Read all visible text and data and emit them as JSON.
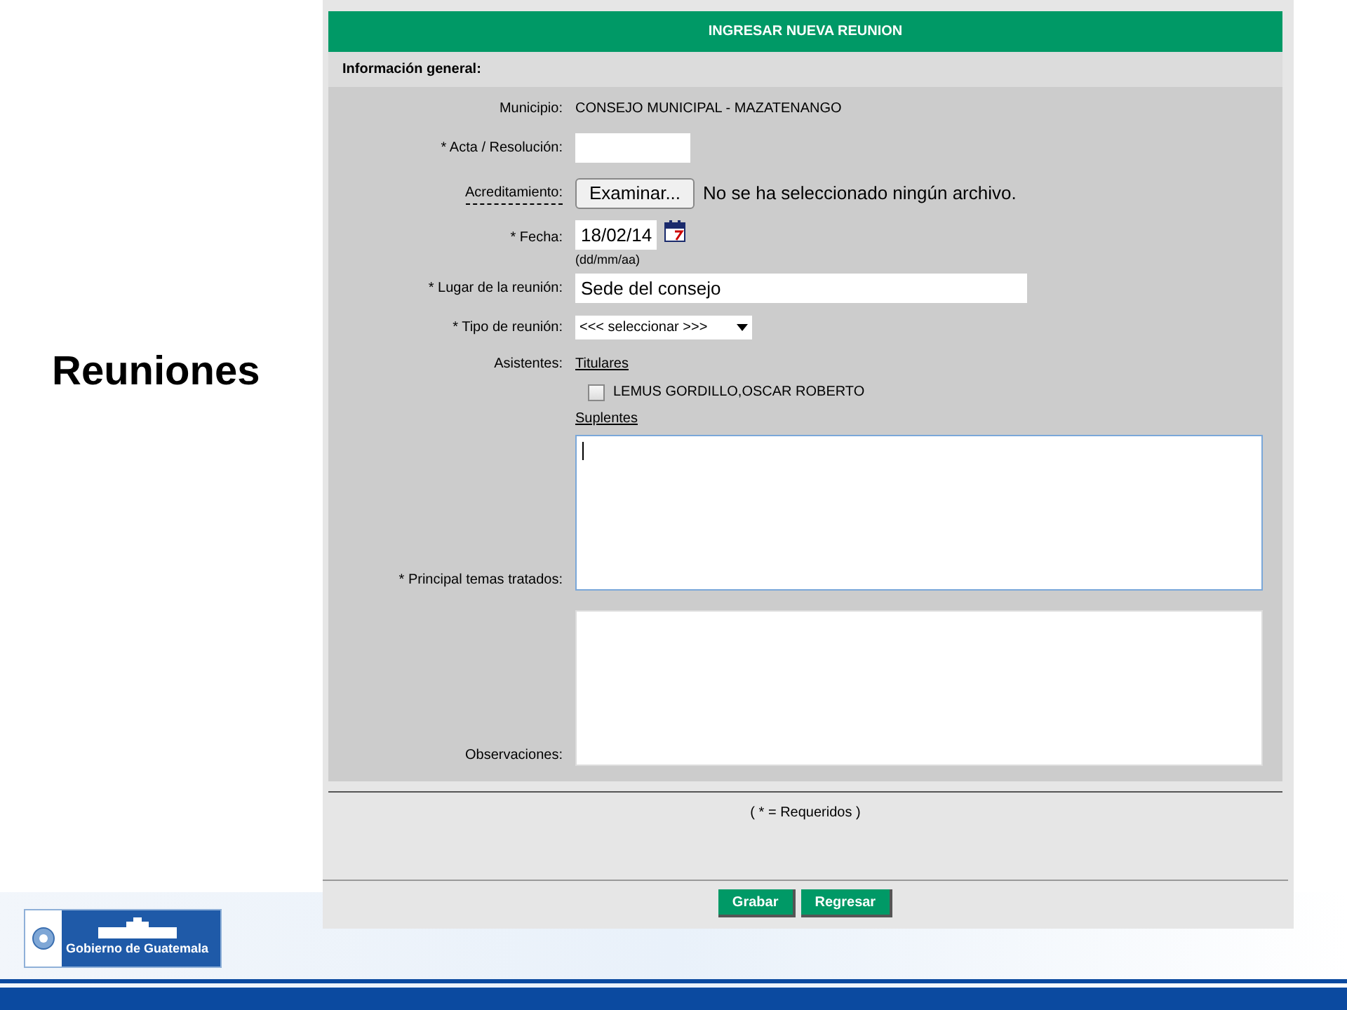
{
  "slide_title": "Reuniones",
  "form": {
    "header": "INGRESAR NUEVA REUNION",
    "section": "Información general:",
    "fields": [
      {
        "kind": "static",
        "label": "Municipio:",
        "value": "CONSEJO MUNICIPAL - MAZATENANGO"
      },
      {
        "kind": "text",
        "label": "* Acta / Resolución:"
      },
      {
        "kind": "file",
        "label": "Acreditamiento:",
        "button": "Examinar...",
        "status": "No se ha seleccionado ningún archivo."
      },
      {
        "kind": "date",
        "label": "* Fecha:",
        "value": "18/02/14",
        "hint": "(dd/mm/aa)"
      },
      {
        "kind": "wide_text",
        "label": "* Lugar de la reunión:",
        "value": "Sede del consejo"
      },
      {
        "kind": "select",
        "label": "* Tipo de reunión:",
        "value": "<<< seleccionar >>>"
      },
      {
        "kind": "attendees",
        "label": "Asistentes:",
        "groups": [
          {
            "title": "Titulares",
            "members": [
              {
                "name": "LEMUS GORDILLO,OSCAR ROBERTO",
                "checked": false
              }
            ]
          },
          {
            "title": "Suplentes"
          }
        ]
      },
      {
        "kind": "textarea",
        "label": "* Principal temas tratados:",
        "focused": true
      },
      {
        "kind": "textarea",
        "label": "Observaciones:",
        "focused": false
      }
    ],
    "required_note": "( * = Requeridos )",
    "buttons": [
      "Grabar",
      "Regresar"
    ]
  },
  "footer": {
    "logo_text": "Gobierno de Guatemala"
  }
}
